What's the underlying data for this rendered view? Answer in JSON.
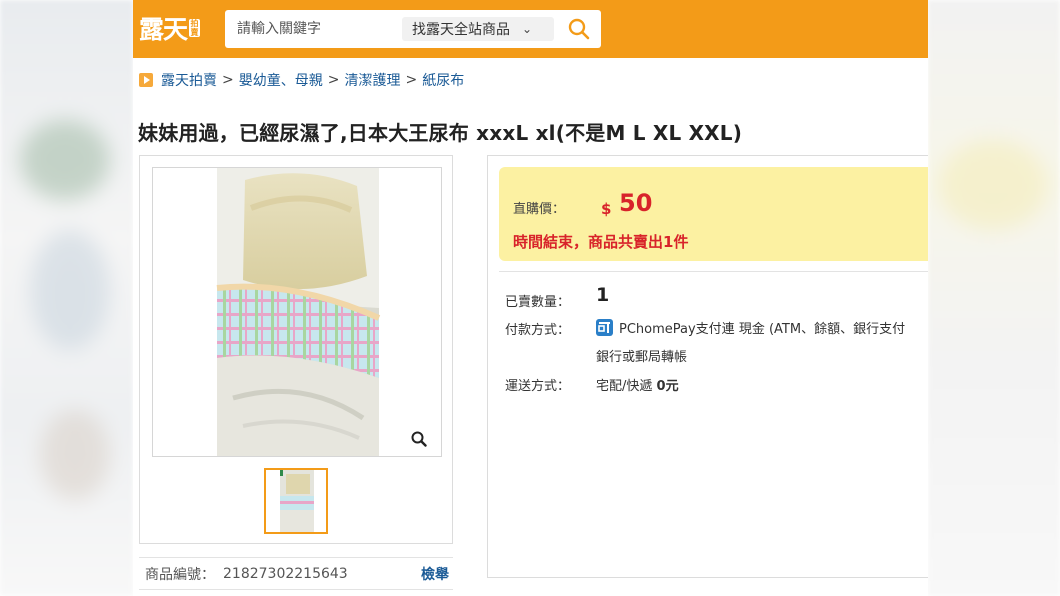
{
  "header": {
    "logo_text": "露天",
    "logo_badge": "拍賣",
    "search_placeholder": "請輸入關鍵字",
    "scope_label": "找露天全站商品",
    "scope_chevron": "⌄",
    "search_icon": "search-icon",
    "brand_color": "#f39b18"
  },
  "breadcrumb": {
    "items": [
      "露天拍賣",
      "嬰幼童、母親",
      "清潔護理",
      "紙尿布"
    ],
    "separator": ">"
  },
  "product": {
    "title": "妹妹用過，已經尿濕了,日本大王尿布 xxxL xl(不是M L XL XXL)",
    "number_label": "商品編號：",
    "number_value": "21827302215643",
    "report_label": "檢舉"
  },
  "price": {
    "label": "直購價：",
    "currency": "$",
    "value": "50",
    "status": "時間結束，商品共賣出1件",
    "accent_color": "#d8232a",
    "box_color": "#fcf1a2"
  },
  "details": {
    "sold_label": "已賣數量：",
    "sold_value": "1",
    "payment_label": "付款方式：",
    "payment_line1": "PChomePay支付連 現金 (ATM、餘額、銀行支付",
    "payment_line2": "銀行或郵局轉帳",
    "shipping_label": "運送方式：",
    "shipping_value": "宅配/快遞",
    "shipping_fee": "0元"
  }
}
